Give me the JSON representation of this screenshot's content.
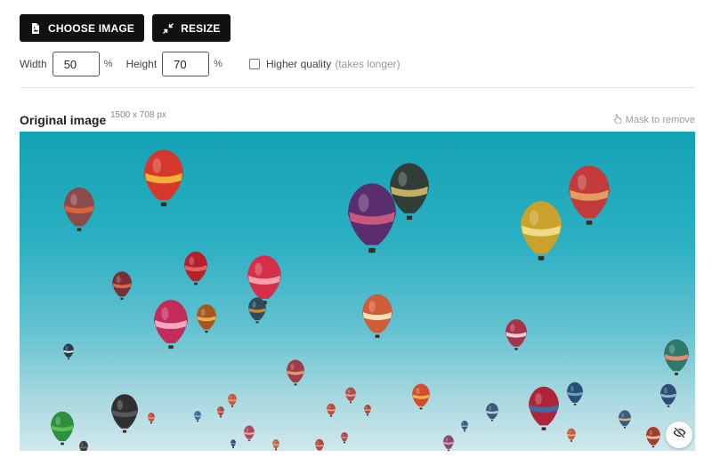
{
  "toolbar": {
    "choose_image_label": "CHOOSE IMAGE",
    "choose_image_icon": "image-file-icon",
    "resize_label": "RESIZE",
    "resize_icon": "shrink-arrows-icon"
  },
  "options": {
    "width_label": "Width",
    "width_value": "50",
    "width_unit": "%",
    "height_label": "Height",
    "height_value": "70",
    "height_unit": "%",
    "higher_quality_label": "Higher quality",
    "higher_quality_note": "(takes longer)",
    "higher_quality_checked": false
  },
  "original": {
    "title": "Original image",
    "dimensions": "1500 x 708 px",
    "mask_label": "Mask to remove",
    "mask_icon": "hand-pointer-icon",
    "visibility_toggle_icon": "eye-slash-icon"
  },
  "colors": {
    "button_bg": "#111111",
    "sky_top": "#15a2b5",
    "sky_bottom": "#d0e8ec"
  }
}
